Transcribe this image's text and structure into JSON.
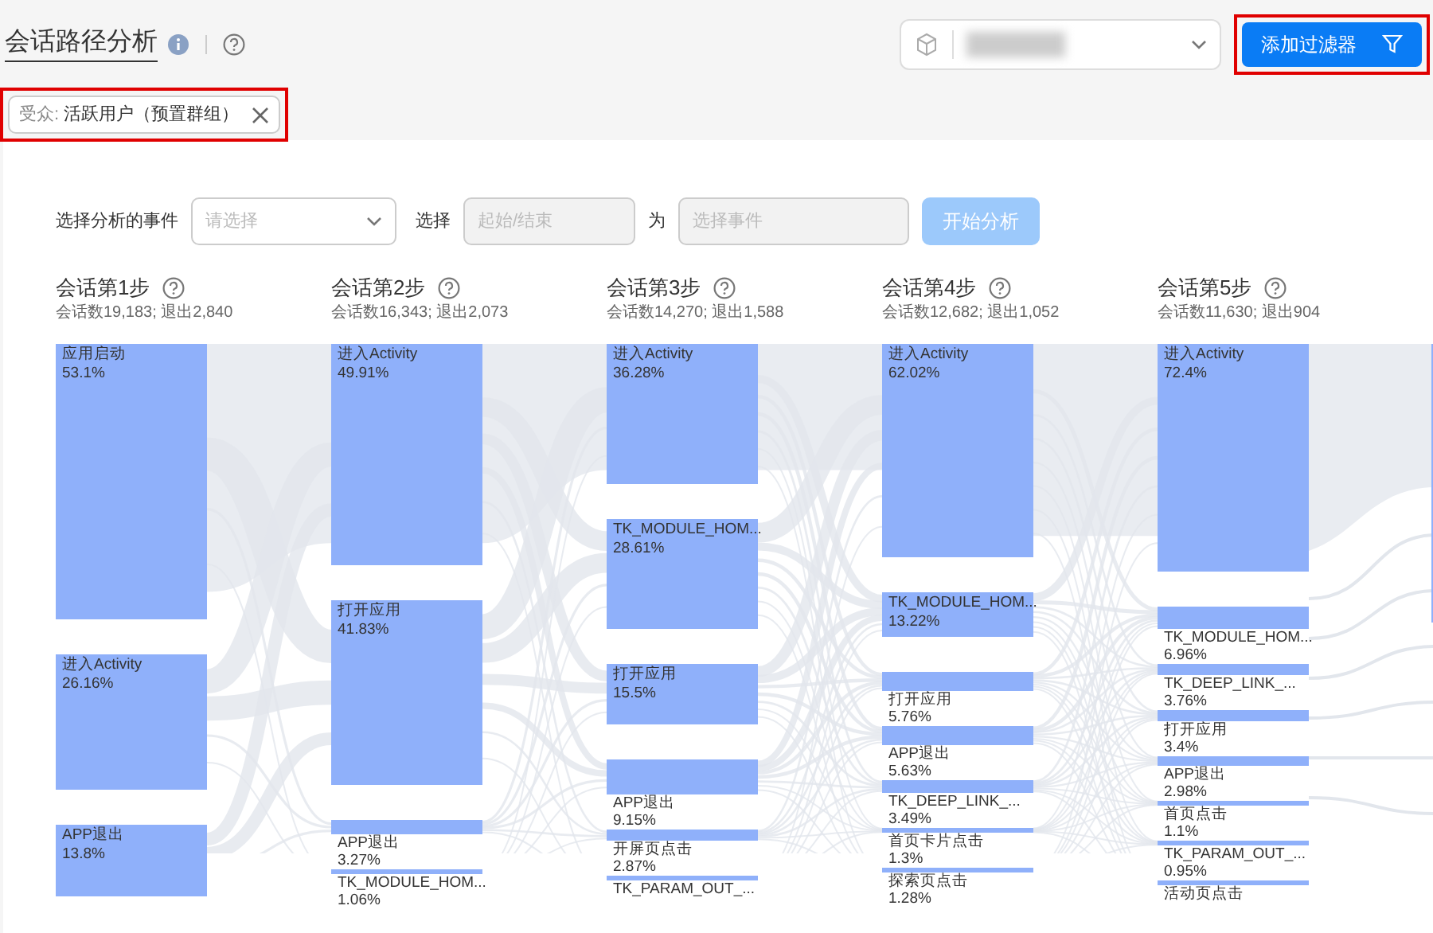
{
  "page": {
    "title": "会话路径分析"
  },
  "filter_button": {
    "label": "添加过滤器",
    "highlighted": true
  },
  "audience_tag": {
    "prefix": "受众:",
    "value": "活跃用户（预置群组）",
    "highlighted": true
  },
  "query": {
    "event_label": "选择分析的事件",
    "event_select": {
      "placeholder": "请选择"
    },
    "select_label": "选择",
    "position_field": {
      "placeholder": "起始/结束",
      "disabled": true
    },
    "for_label": "为",
    "target_field": {
      "placeholder": "选择事件",
      "disabled": true
    },
    "start_button": {
      "label": "开始分析",
      "disabled": true
    }
  },
  "steps": [
    {
      "title": "会话第1步",
      "stats": "会话数19,183; 退出2,840",
      "nodes": [
        {
          "name": "应用启动",
          "percent": "53.1%"
        },
        {
          "name": "进入Activity",
          "percent": "26.16%"
        },
        {
          "name": "APP退出",
          "percent": "13.8%"
        }
      ]
    },
    {
      "title": "会话第2步",
      "stats": "会话数16,343; 退出2,073",
      "nodes": [
        {
          "name": "进入Activity",
          "percent": "49.91%"
        },
        {
          "name": "打开应用",
          "percent": "41.83%"
        },
        {
          "name": "APP退出",
          "percent": "3.27%"
        },
        {
          "name": "TK_MODULE_HOM...",
          "percent": "1.06%"
        }
      ]
    },
    {
      "title": "会话第3步",
      "stats": "会话数14,270; 退出1,588",
      "nodes": [
        {
          "name": "进入Activity",
          "percent": "36.28%"
        },
        {
          "name": "TK_MODULE_HOM...",
          "percent": "28.61%"
        },
        {
          "name": "打开应用",
          "percent": "15.5%"
        },
        {
          "name": "APP退出",
          "percent": "9.15%"
        },
        {
          "name": "开屏页点击",
          "percent": "2.87%"
        },
        {
          "name": "TK_PARAM_OUT_..."
        }
      ]
    },
    {
      "title": "会话第4步",
      "stats": "会话数12,682; 退出1,052",
      "nodes": [
        {
          "name": "进入Activity",
          "percent": "62.02%"
        },
        {
          "name": "TK_MODULE_HOM...",
          "percent": "13.22%"
        },
        {
          "name": "打开应用",
          "percent": "5.76%"
        },
        {
          "name": "APP退出",
          "percent": "5.63%"
        },
        {
          "name": "TK_DEEP_LINK_...",
          "percent": "3.49%"
        },
        {
          "name": "首页卡片点击",
          "percent": "1.3%"
        },
        {
          "name": "探索页点击",
          "percent": "1.28%"
        }
      ]
    },
    {
      "title": "会话第5步",
      "stats": "会话数11,630; 退出904",
      "nodes": [
        {
          "name": "进入Activity",
          "percent": "72.4%"
        },
        {
          "name": "TK_MODULE_HOM...",
          "percent": "6.96%"
        },
        {
          "name": "TK_DEEP_LINK_...",
          "percent": "3.76%"
        },
        {
          "name": "打开应用",
          "percent": "3.4%"
        },
        {
          "name": "APP退出",
          "percent": "2.98%"
        },
        {
          "name": "首页点击",
          "percent": "1.1%"
        },
        {
          "name": "TK_PARAM_OUT_...",
          "percent": "0.95%"
        },
        {
          "name": "活动页点击"
        }
      ]
    }
  ]
}
